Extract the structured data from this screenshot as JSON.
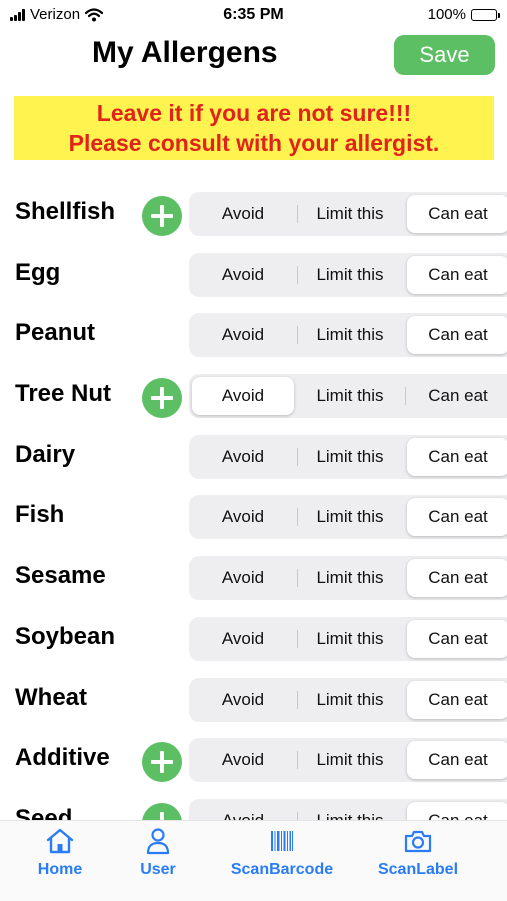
{
  "status_bar": {
    "carrier": "Verizon",
    "time": "6:35 PM",
    "battery": "100%"
  },
  "header": {
    "title": "My Allergens",
    "save_label": "Save"
  },
  "warning": {
    "line1": "Leave it if you are not sure!!!",
    "line2": "Please consult with your allergist."
  },
  "options": [
    "Avoid",
    "Limit this",
    "Can eat"
  ],
  "allergens": [
    {
      "name": "Shellfish",
      "has_add": true,
      "selected": 2
    },
    {
      "name": "Egg",
      "has_add": false,
      "selected": 2
    },
    {
      "name": "Peanut",
      "has_add": false,
      "selected": 2
    },
    {
      "name": "Tree Nut",
      "has_add": true,
      "selected": 0
    },
    {
      "name": "Dairy",
      "has_add": false,
      "selected": 2
    },
    {
      "name": "Fish",
      "has_add": false,
      "selected": 2
    },
    {
      "name": "Sesame",
      "has_add": false,
      "selected": 2
    },
    {
      "name": "Soybean",
      "has_add": false,
      "selected": 2
    },
    {
      "name": "Wheat",
      "has_add": false,
      "selected": 2
    },
    {
      "name": "Additive",
      "has_add": true,
      "selected": 2
    },
    {
      "name": "Seed",
      "has_add": true,
      "selected": 2
    }
  ],
  "tabs": {
    "home": "Home",
    "user": "User",
    "scanbarcode": "ScanBarcode",
    "scanlabel": "ScanLabel"
  },
  "colors": {
    "accent_green": "#5cbf63",
    "tab_blue": "#2a7cf6",
    "warning_bg": "#fff44f",
    "warning_text": "#e0231b"
  },
  "icons": [
    "signal-icon",
    "wifi-icon",
    "battery-icon",
    "plus-icon",
    "home-icon",
    "user-icon",
    "barcode-icon",
    "camera-icon"
  ]
}
